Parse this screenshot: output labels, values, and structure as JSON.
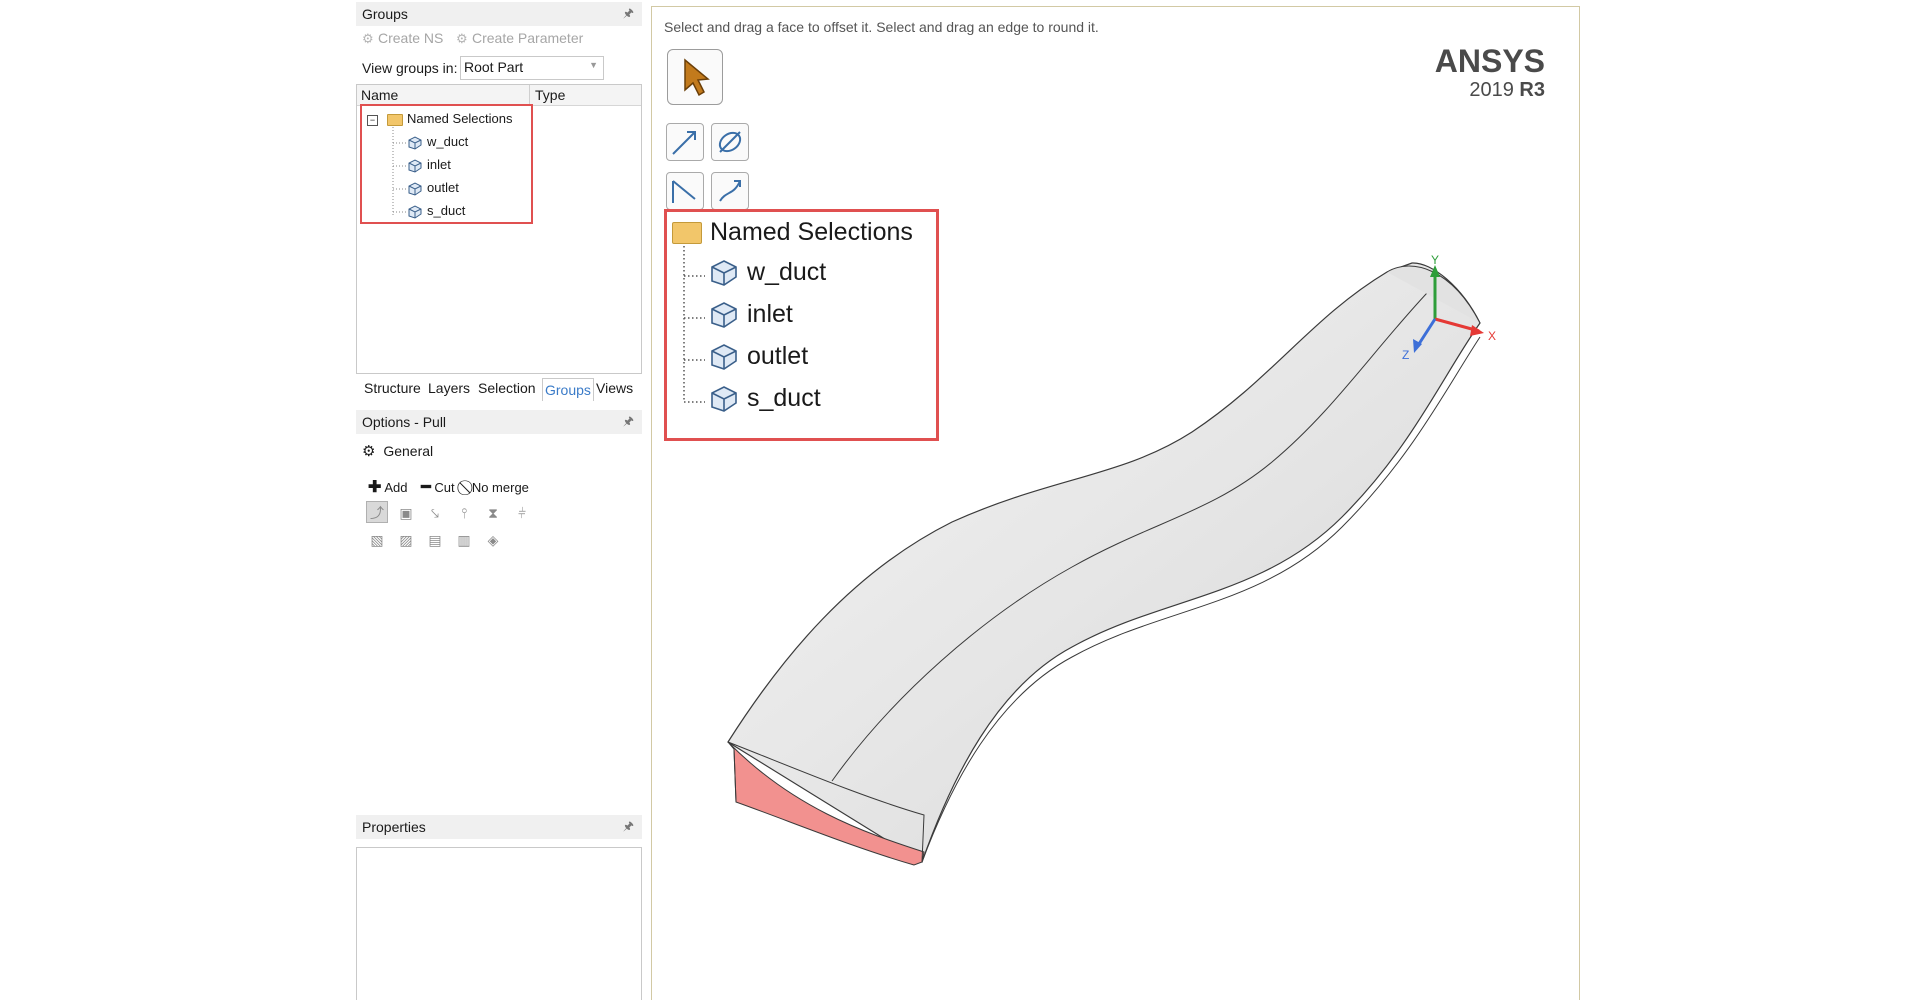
{
  "groups_panel": {
    "title": "Groups",
    "create_ns": "Create NS",
    "create_parameter": "Create Parameter",
    "view_groups_label": "View groups in:",
    "view_groups_value": "Root Part",
    "columns": {
      "name": "Name",
      "type": "Type"
    },
    "tree": {
      "root": "Named Selections",
      "items": [
        "w_duct",
        "inlet",
        "outlet",
        "s_duct"
      ]
    }
  },
  "tabs": [
    "Structure",
    "Layers",
    "Selection",
    "Groups",
    "Views"
  ],
  "active_tab": "Groups",
  "options_panel": {
    "title": "Options - Pull",
    "section": "General",
    "add": "Add",
    "cut": "Cut",
    "no_merge": "No merge"
  },
  "properties_panel": {
    "title": "Properties"
  },
  "viewport": {
    "hint": "Select and drag a face to offset it. Select and drag an edge to round it.",
    "brand": "ANSYS",
    "version_year": "2019",
    "version_release": "R3",
    "axes": {
      "x": "X",
      "y": "Y",
      "z": "Z"
    },
    "named_selections_callout": {
      "root": "Named Selections",
      "items": [
        "w_duct",
        "inlet",
        "outlet",
        "s_duct"
      ]
    }
  },
  "colors": {
    "highlight_border": "#e05050",
    "inlet_face": "#f2918f",
    "axis_x": "#e53935",
    "axis_y": "#2e9e3a",
    "axis_z": "#3d6fd8",
    "active_tab": "#3a7bc8"
  }
}
